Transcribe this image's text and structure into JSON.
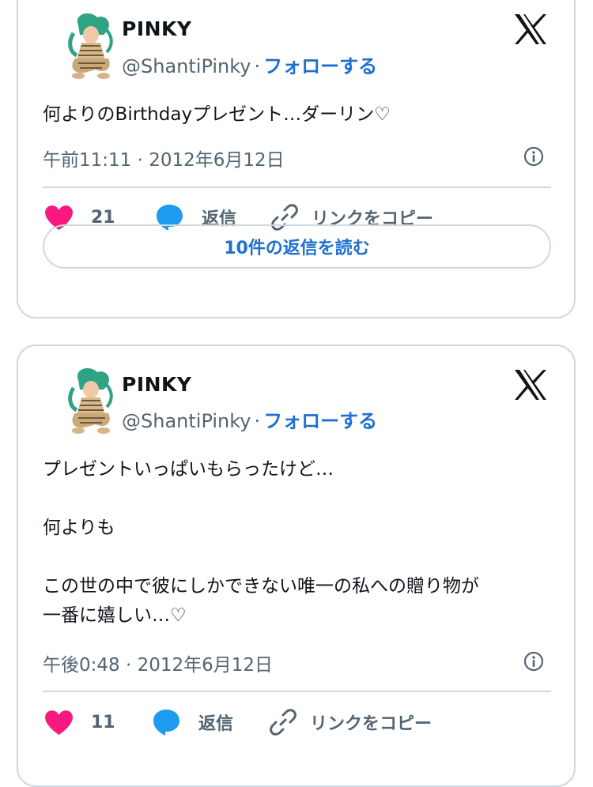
{
  "tweets": [
    {
      "display_name": "PINKY",
      "handle": "@ShantiPinky",
      "separator": "·",
      "follow_label": "フォローする",
      "text_lines": [
        "何よりのBirthdayプレゼント…ダーリン♡"
      ],
      "timestamp": "午前11:11 · 2012年6月12日",
      "likes": "21",
      "reply_label": "返信",
      "copy_link_label": "リンクをコピー",
      "read_replies_label": "10件の返信を読む"
    },
    {
      "display_name": "PINKY",
      "handle": "@ShantiPinky",
      "separator": "·",
      "follow_label": "フォローする",
      "text_lines": [
        "プレゼントいっぱいもらったけど…",
        "",
        "何よりも",
        "",
        "この世の中で彼にしかできない唯一の私への贈り物が",
        "一番に嬉しい…♡"
      ],
      "timestamp": "午後0:48 · 2012年6月12日",
      "likes": "11",
      "reply_label": "返信",
      "copy_link_label": "リンクをコピー"
    }
  ],
  "colors": {
    "heart": "#f91880",
    "reply_bubble": "#1d9bf0",
    "follow_link": "#1d6fd0",
    "muted_text": "#536471",
    "border": "#cfd9de"
  },
  "icons": {
    "like": "heart-icon",
    "reply": "speech-bubble-icon",
    "copy": "link-icon",
    "brand": "x-logo-icon",
    "info": "info-icon"
  }
}
